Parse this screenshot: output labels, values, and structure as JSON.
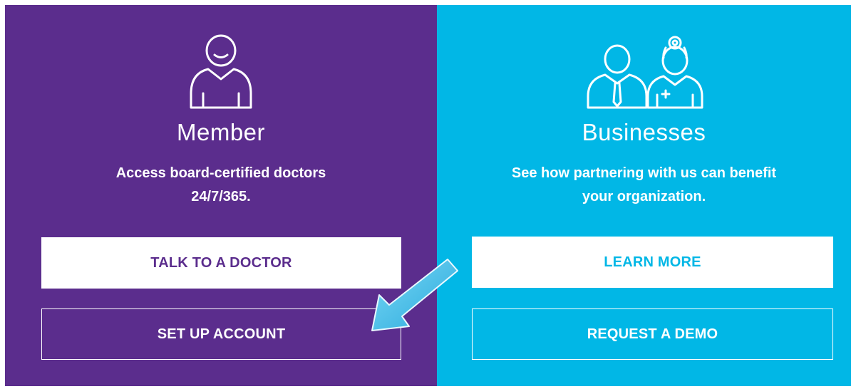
{
  "member": {
    "icon": "member-person-icon",
    "title": "Member",
    "description": "Access board-certified doctors 24/7/365.",
    "primary_button": "TALK TO A DOCTOR",
    "secondary_button": "SET UP ACCOUNT",
    "background_color": "#5b2d8d"
  },
  "businesses": {
    "icon": "business-people-icon",
    "title": "Businesses",
    "description": "See how partnering with us can benefit your organization.",
    "primary_button": "LEARN MORE",
    "secondary_button": "REQUEST A DEMO",
    "background_color": "#01b7e6"
  },
  "annotation": {
    "icon": "pointer-arrow-icon",
    "color": "#3fbfe8"
  }
}
